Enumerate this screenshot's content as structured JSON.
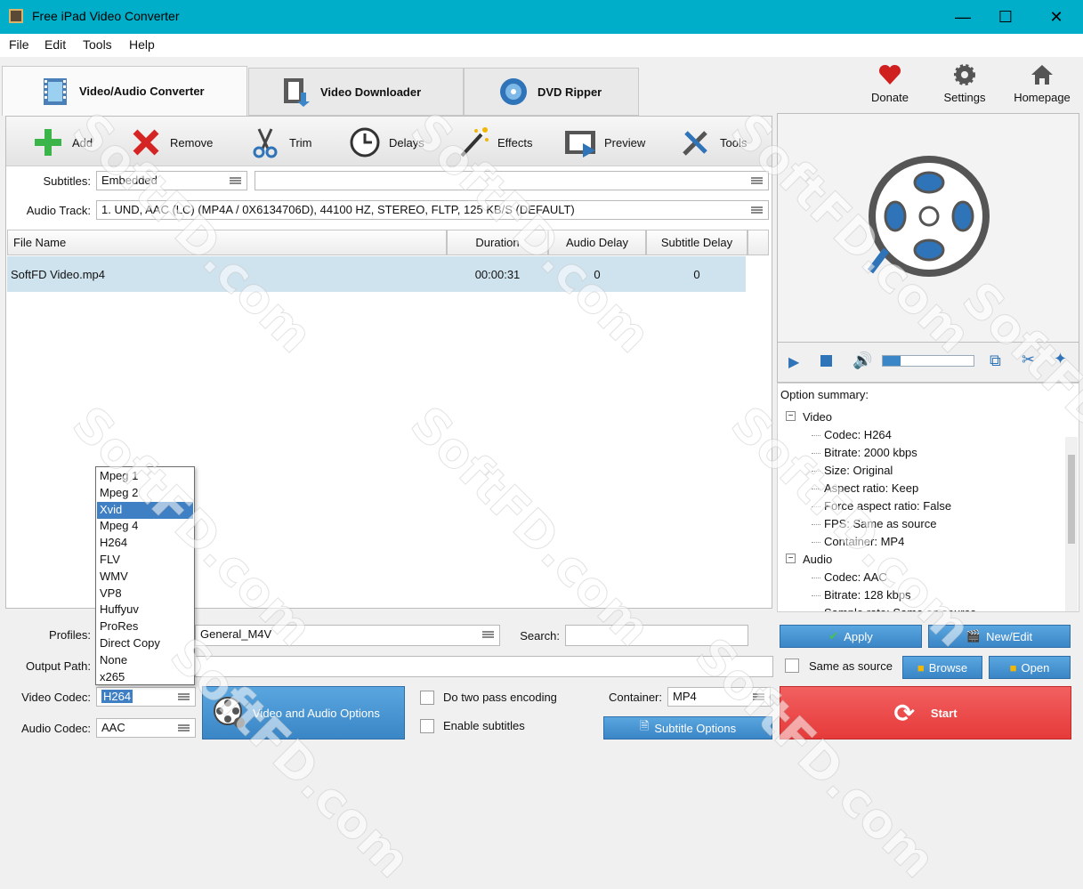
{
  "window": {
    "title": "Free iPad Video Converter"
  },
  "menu": [
    "File",
    "Edit",
    "Tools",
    "Help"
  ],
  "tabs": [
    {
      "label": "Video/Audio Converter",
      "icon": "film-icon",
      "active": true
    },
    {
      "label": "Video Downloader",
      "icon": "film-download-icon",
      "active": false
    },
    {
      "label": "DVD Ripper",
      "icon": "dvd-icon",
      "active": false
    }
  ],
  "top_actions": {
    "donate": "Donate",
    "settings": "Settings",
    "homepage": "Homepage"
  },
  "toolbar": {
    "add": "Add",
    "remove": "Remove",
    "trim": "Trim",
    "delays": "Delays",
    "effects": "Effects",
    "preview": "Preview",
    "tools": "Tools"
  },
  "subtitles": {
    "label": "Subtitles:",
    "value": "Embedded",
    "second_value": ""
  },
  "audio_track": {
    "label": "Audio Track:",
    "value": "1. UND, AAC (LC) (MP4A / 0X6134706D), 44100 HZ, STEREO, FLTP, 125 KB/S (DEFAULT)"
  },
  "table": {
    "columns": [
      "File Name",
      "Duration",
      "Audio Delay",
      "Subtitle Delay"
    ],
    "rows": [
      {
        "file": "SoftFD Video.mp4",
        "duration": "00:00:31",
        "audio_delay": "0",
        "subtitle_delay": "0"
      }
    ]
  },
  "summary": {
    "title": "Option summary:",
    "video_label": "Video",
    "video_items": [
      "Codec: H264",
      "Bitrate: 2000 kbps",
      "Size:  Original",
      "Aspect ratio: Keep",
      "Force aspect ratio: False",
      "FPS: Same as source",
      "Container: MP4"
    ],
    "audio_label": "Audio",
    "audio_items": [
      "Codec: AAC",
      "Bitrate: 128 kbps",
      "Sample rate: Same as source"
    ]
  },
  "bottom": {
    "profiles_label": "Profiles:",
    "profiles_value": "General_M4V",
    "search_label": "Search:",
    "search_value": "",
    "output_label": "Output Path:",
    "output_value": "",
    "video_codec_label": "Video Codec:",
    "video_codec_value": "H264",
    "audio_codec_label": "Audio Codec:",
    "audio_codec_value": "AAC",
    "va_options": "Video and Audio Options",
    "two_pass": "Do two pass encoding",
    "enable_subs": "Enable subtitles",
    "container_label": "Container:",
    "container_value": "MP4",
    "subtitle_options": "Subtitle Options",
    "apply": "Apply",
    "new_edit": "New/Edit",
    "same_as_source": "Same as source",
    "browse": "Browse",
    "open": "Open",
    "start": "Start"
  },
  "codec_dropdown": {
    "options": [
      "Mpeg 1",
      "Mpeg 2",
      "Xvid",
      "Mpeg 4",
      "H264",
      "FLV",
      "WMV",
      "VP8",
      "Huffyuv",
      "ProRes",
      "Direct Copy",
      "None",
      "x265"
    ],
    "highlighted": "Xvid"
  },
  "watermark": "SoftFD.com",
  "colors": {
    "titlebar": "#00aec9",
    "selection": "#cfe3ef",
    "accent_blue": "#3a86c6",
    "start_red": "#ee4a4a"
  }
}
